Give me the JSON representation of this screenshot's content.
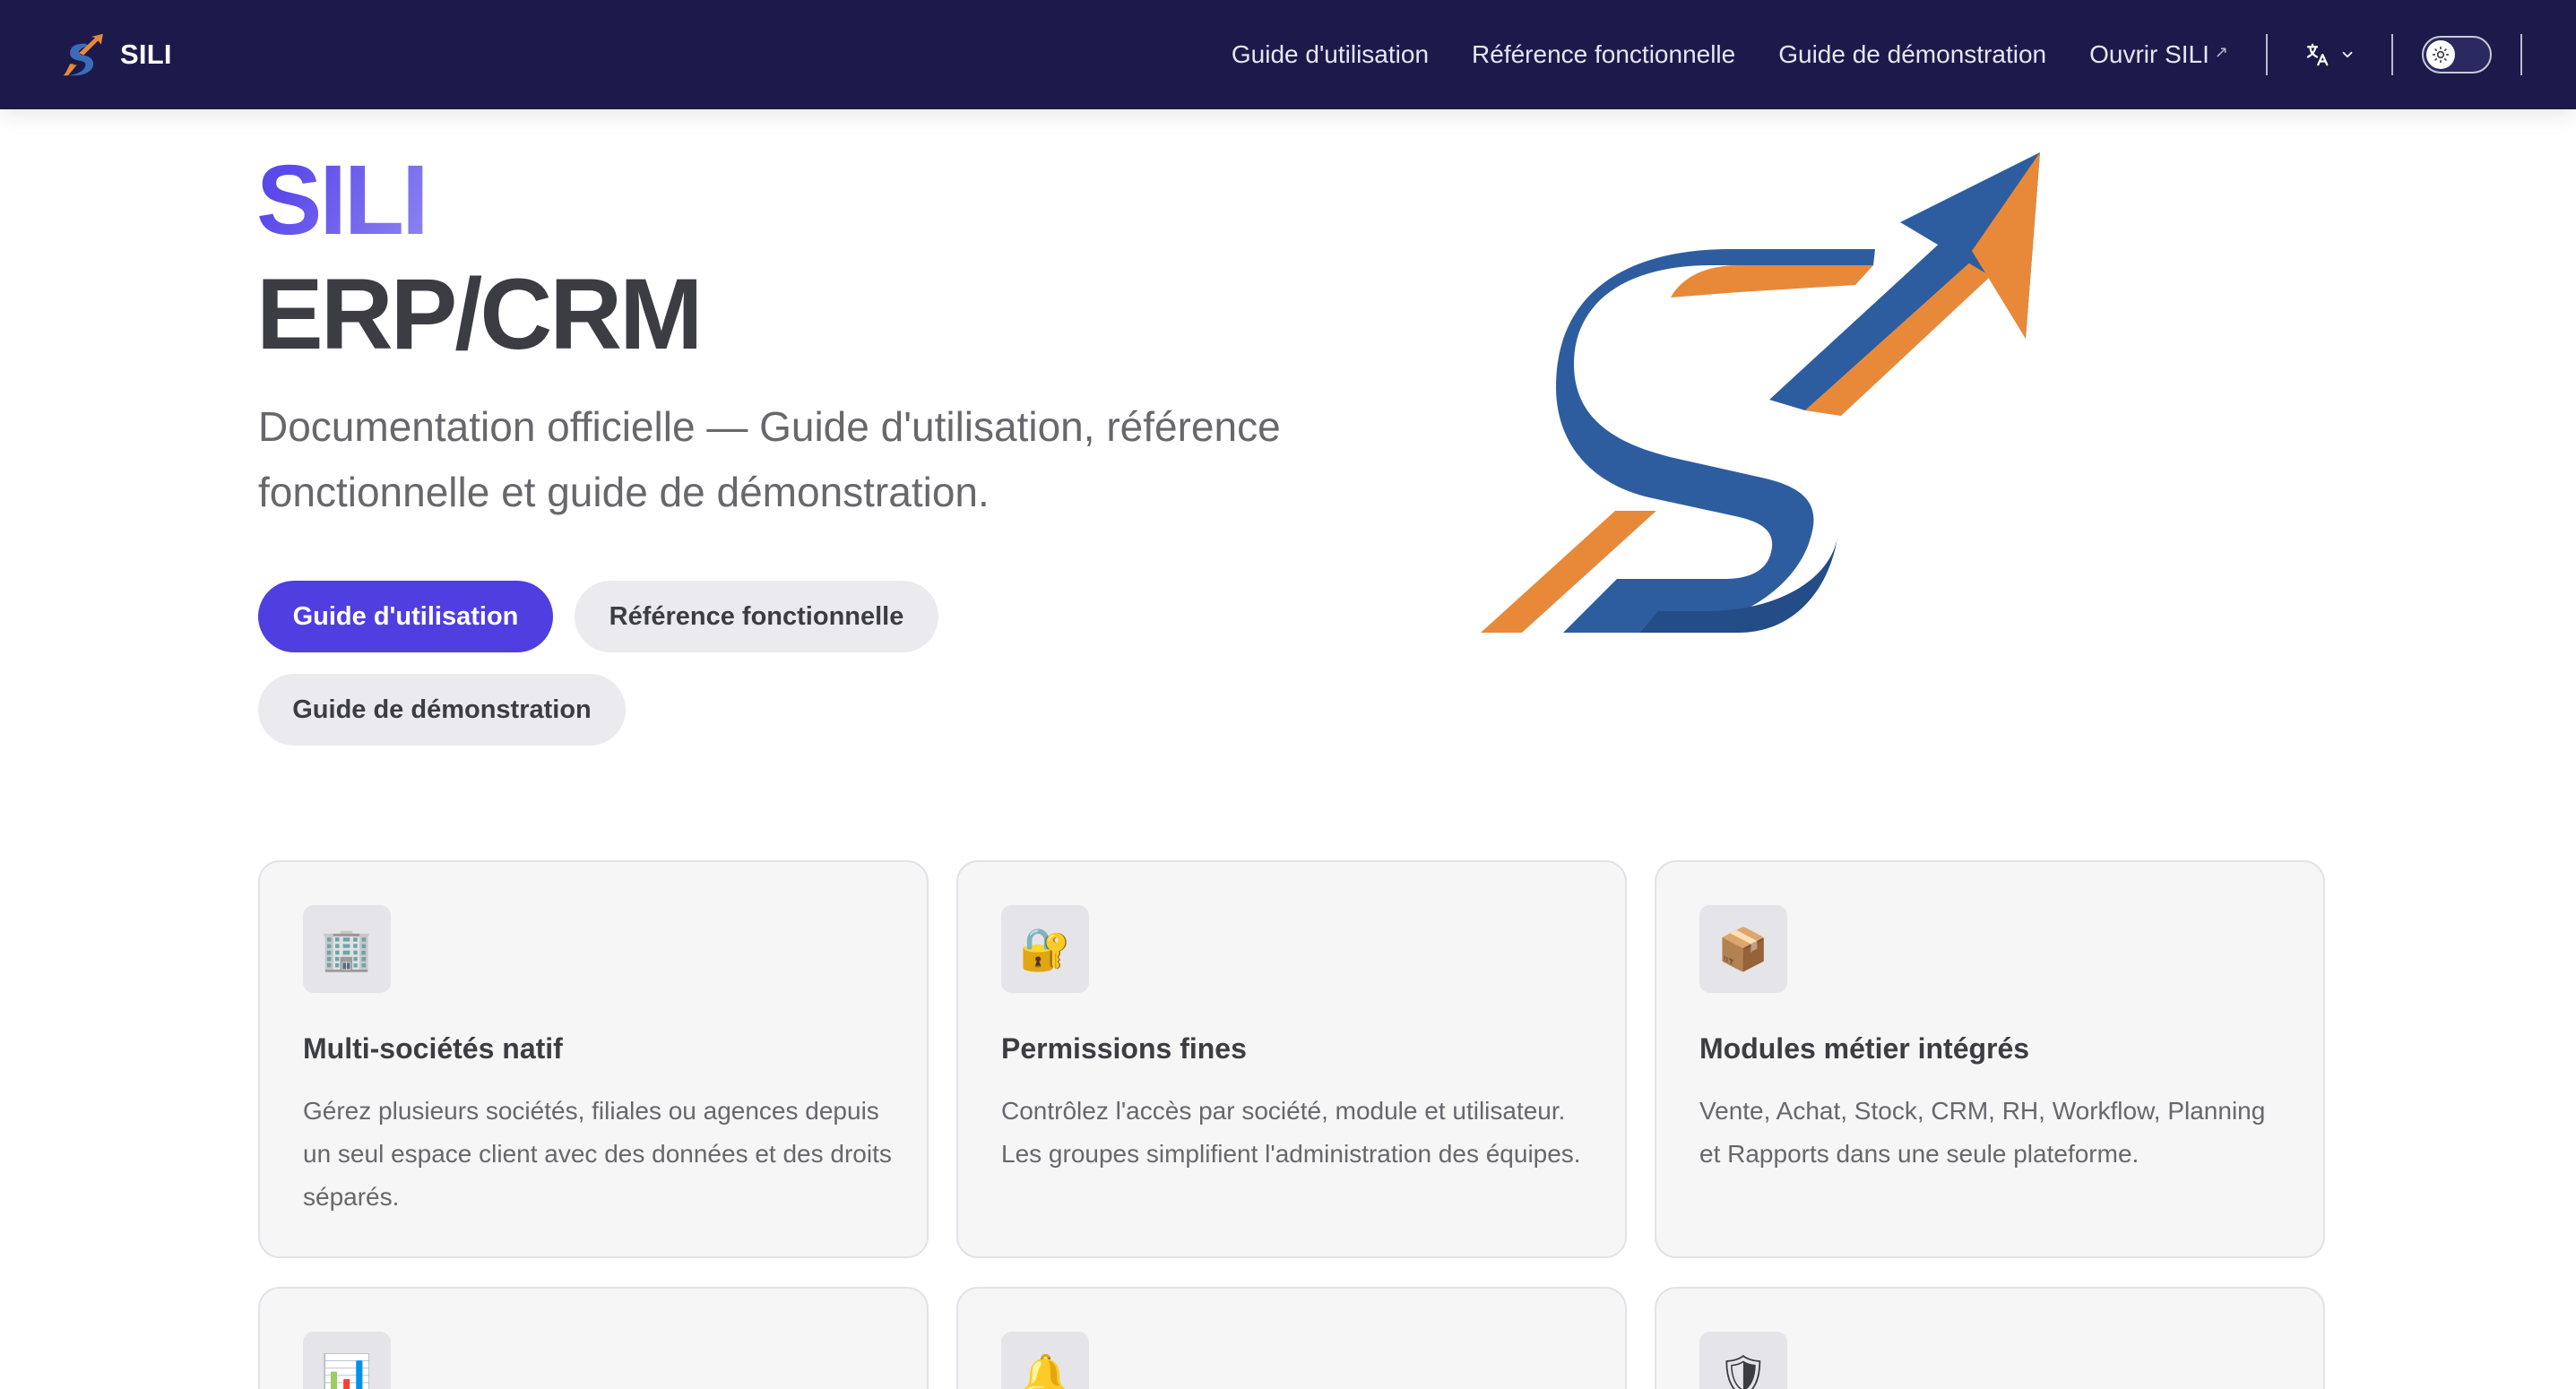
{
  "nav": {
    "brand": "SILI",
    "links": [
      {
        "label": "Guide d'utilisation"
      },
      {
        "label": "Référence fonctionnelle"
      },
      {
        "label": "Guide de démonstration"
      },
      {
        "label": "Ouvrir SILI",
        "external_icon": "arrow-up-right-icon"
      }
    ],
    "language_icon": "translate-icon",
    "theme_toggle_icon": "sun-icon"
  },
  "hero": {
    "name": "SILI",
    "text": "ERP/CRM",
    "tagline": "Documentation officielle — Guide d'utilisation, référence fonctionnelle et guide de démonstration.",
    "actions": {
      "primary": "Guide d'utilisation",
      "secondary": "Référence fonctionnelle",
      "tertiary": "Guide de démonstration"
    }
  },
  "features": [
    {
      "icon": "🏢",
      "icon_name": "office-building-icon",
      "title": "Multi-sociétés natif",
      "details": "Gérez plusieurs sociétés, filiales ou agences depuis un seul espace client avec des données et des droits séparés."
    },
    {
      "icon": "🔐",
      "icon_name": "lock-with-key-icon",
      "title": "Permissions fines",
      "details": "Contrôlez l'accès par société, module et utilisateur. Les groupes simplifient l'administration des équipes."
    },
    {
      "icon": "📦",
      "icon_name": "package-icon",
      "title": "Modules métier intégrés",
      "details": "Vente, Achat, Stock, CRM, RH, Workflow, Planning et Rapports dans une seule plateforme."
    },
    {
      "icon": "📊",
      "icon_name": "bar-chart-icon"
    },
    {
      "icon": "🔔",
      "icon_name": "bell-icon"
    },
    {
      "icon": "🛡",
      "icon_name": "shield-icon"
    }
  ],
  "colors": {
    "navbar": "#1b1a4b",
    "brand_blue": "#2e5d9f",
    "brand_orange": "#e8893a",
    "primary_button": "#4f3fe0"
  }
}
